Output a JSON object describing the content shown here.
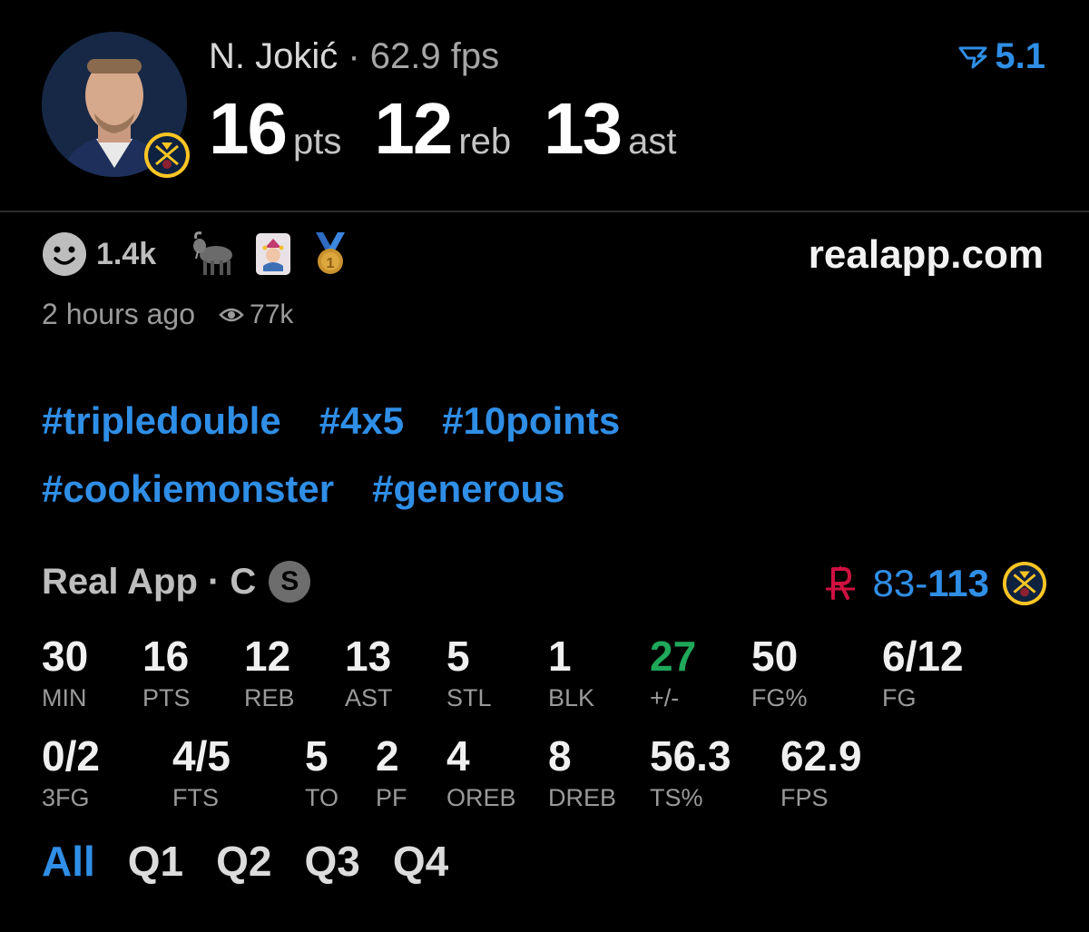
{
  "header": {
    "player_name": "N. Jokić",
    "separator": " · ",
    "fps_text": "62.9 fps",
    "score_value": "5.1",
    "headline": [
      {
        "value": "16",
        "unit": "pts"
      },
      {
        "value": "12",
        "unit": "reb"
      },
      {
        "value": "13",
        "unit": "ast"
      }
    ]
  },
  "reactions": {
    "count": "1.4k",
    "icons": [
      "smiley-icon",
      "goat-emoji-icon",
      "joker-card-emoji-icon",
      "medal-emoji-icon"
    ],
    "time_ago": "2 hours ago",
    "views": "77k"
  },
  "site": "realapp.com",
  "hashtags": [
    "#tripledouble",
    "#4x5",
    "#10points",
    "#cookiemonster",
    "#generous"
  ],
  "stats_header": {
    "title": "Real App · C",
    "badge": "S",
    "away_score": "83",
    "dash": "-",
    "home_score": "113"
  },
  "stats_row1": [
    {
      "value": "30",
      "label": "MIN"
    },
    {
      "value": "16",
      "label": "PTS"
    },
    {
      "value": "12",
      "label": "REB"
    },
    {
      "value": "13",
      "label": "AST"
    },
    {
      "value": "5",
      "label": "STL"
    },
    {
      "value": "1",
      "label": "BLK"
    },
    {
      "value": "27",
      "label": "+/-"
    },
    {
      "value": "50",
      "label": "FG%"
    },
    {
      "value": "6/12",
      "label": "FG"
    }
  ],
  "stats_row2": [
    {
      "value": "0/2",
      "label": "3FG"
    },
    {
      "value": "4/5",
      "label": "FTS"
    },
    {
      "value": "5",
      "label": "TO"
    },
    {
      "value": "2",
      "label": "PF"
    },
    {
      "value": "4",
      "label": "OREB"
    },
    {
      "value": "8",
      "label": "DREB"
    },
    {
      "value": "56.3",
      "label": "TS%"
    },
    {
      "value": "62.9",
      "label": "FPS"
    }
  ],
  "tabs": [
    "All",
    "Q1",
    "Q2",
    "Q3",
    "Q4"
  ],
  "colors": {
    "accent_blue": "#2f8ee6",
    "plus_minus_green": "#1fa85a",
    "rockets_red": "#ce1141",
    "nuggets_gold": "#fec524",
    "nuggets_navy": "#0e2240"
  }
}
